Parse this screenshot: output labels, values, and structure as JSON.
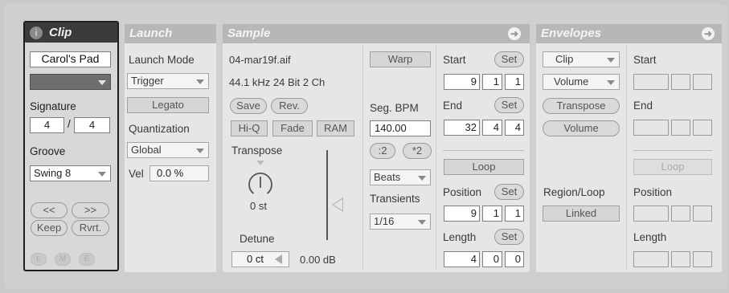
{
  "clip": {
    "title": "Clip",
    "name": "Carol's Pad",
    "signature_label": "Signature",
    "sig_num": "4",
    "sig_sep": "/",
    "sig_den": "4",
    "groove_label": "Groove",
    "groove_value": "Swing 8",
    "prev_label": "<<",
    "next_label": ">>",
    "keep_label": "Keep",
    "revert_label": "Rvrt.",
    "footer_l": "L",
    "footer_m": "M",
    "footer_e": "E"
  },
  "launch": {
    "title": "Launch",
    "mode_label": "Launch Mode",
    "mode_value": "Trigger",
    "legato_label": "Legato",
    "quant_label": "Quantization",
    "quant_value": "Global",
    "vel_label": "Vel",
    "vel_value": "0.0 %"
  },
  "sample": {
    "title": "Sample",
    "filename": "04-mar19f.aif",
    "format": "44.1 kHz 24 Bit 2 Ch",
    "save": "Save",
    "rev": "Rev.",
    "hiq": "Hi-Q",
    "fade": "Fade",
    "ram": "RAM",
    "transpose_label": "Transpose",
    "transpose_value": "0 st",
    "detune_label": "Detune",
    "detune_value": "0 ct",
    "gain_value": "0.00 dB",
    "warp": "Warp",
    "seg_bpm_label": "Seg. BPM",
    "seg_bpm_value": "140.00",
    "half": ":2",
    "double": "*2",
    "warp_mode": "Beats",
    "transients_label": "Transients",
    "transients_value": "1/16",
    "start_label": "Start",
    "set": "Set",
    "start": [
      "9",
      "1",
      "1"
    ],
    "end_label": "End",
    "end": [
      "32",
      "4",
      "4"
    ],
    "loop": "Loop",
    "position_label": "Position",
    "position": [
      "9",
      "1",
      "1"
    ],
    "length_label": "Length",
    "length": [
      "4",
      "0",
      "0"
    ]
  },
  "envelopes": {
    "title": "Envelopes",
    "source": "Clip",
    "control": "Volume",
    "transpose": "Transpose",
    "volume": "Volume",
    "region_loop_label": "Region/Loop",
    "linked": "Linked",
    "start_label": "Start",
    "end_label": "End",
    "loop": "Loop",
    "position_label": "Position",
    "length_label": "Length"
  },
  "colors": {
    "header": "#b7b7b7",
    "clip_header": "#3b3b3b",
    "panel": "#e6e6e6",
    "clip_panel": "#d8d8d8"
  }
}
